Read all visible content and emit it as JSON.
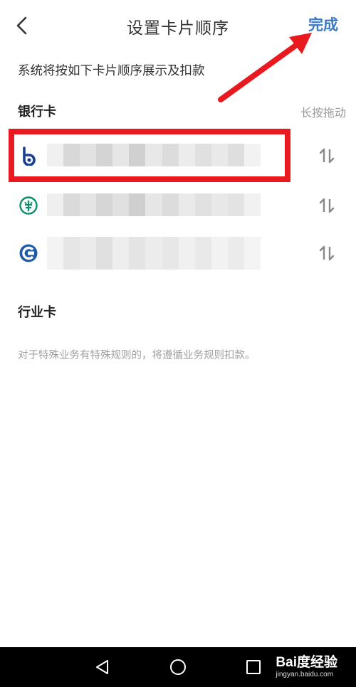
{
  "header": {
    "title": "设置卡片顺序",
    "back_icon": "chevron-left-icon",
    "done_label": "完成",
    "done_color": "#3a78c2"
  },
  "description": "系统将按如下卡片顺序展示及扣款",
  "bank_section": {
    "title": "银行卡",
    "hint": "长按拖动",
    "cards": [
      {
        "logo": "bank-of-shanghai-logo-icon",
        "name": "",
        "highlighted": true
      },
      {
        "logo": "agricultural-bank-logo-icon",
        "name": ""
      },
      {
        "logo": "bank-of-communications-logo-icon",
        "name": ""
      }
    ]
  },
  "industry_section": {
    "title": "行业卡",
    "note": "对于特殊业务有特殊规则的，将遵循业务规则扣款。"
  },
  "annotation": {
    "color": "#e8191f"
  },
  "navbar": {
    "back_icon": "nav-back-triangle-icon",
    "home_icon": "nav-home-circle-icon",
    "recents_icon": "nav-recents-square-icon"
  },
  "watermark": {
    "main": "Bai度经验",
    "sub": "jingyan.baidu.com"
  }
}
